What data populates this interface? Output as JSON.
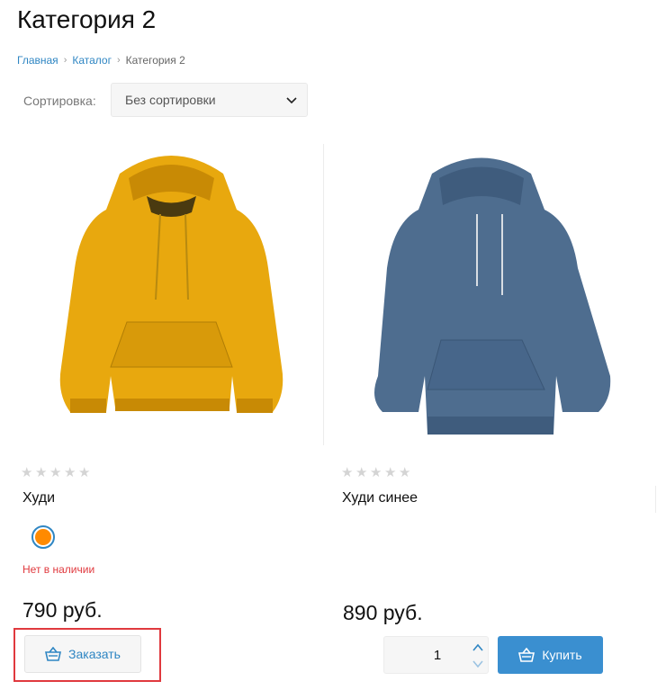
{
  "page": {
    "title": "Категория 2"
  },
  "breadcrumb": {
    "home": "Главная",
    "catalog": "Каталог",
    "current": "Категория 2"
  },
  "sort": {
    "label": "Сортировка:",
    "selected": "Без сортировки"
  },
  "products": [
    {
      "name": "Худи",
      "rating": 0,
      "color": "#e8a80e",
      "swatch_color": "#ff8a00",
      "stock": "Нет в наличии",
      "price": "790 руб.",
      "button": "Заказать"
    },
    {
      "name": "Худи синее",
      "rating": 0,
      "color": "#4e6d8f",
      "price": "890 руб.",
      "quantity": "1",
      "button": "Купить"
    }
  ],
  "colors": {
    "accent": "#2f86c3",
    "buy_button": "#3a8fd0",
    "out_of_stock": "#e0393e",
    "highlight_box": "#e0393e"
  }
}
